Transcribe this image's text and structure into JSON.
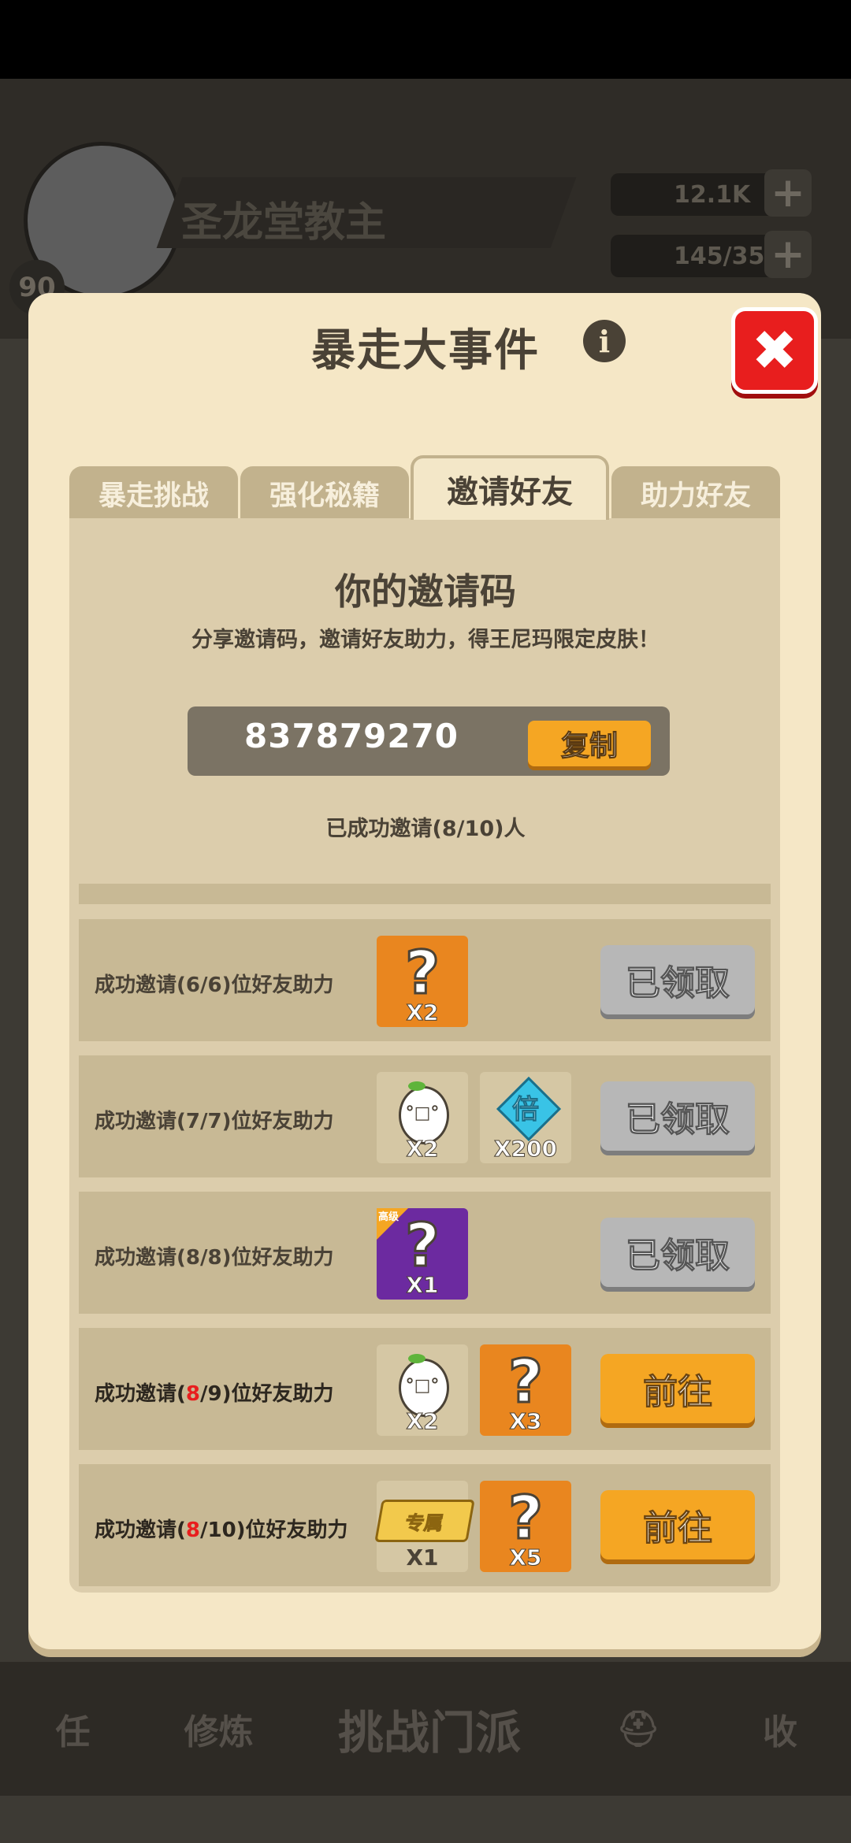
{
  "background": {
    "player_name": "圣龙堂教主",
    "player_level": "90",
    "coins": "12.1K",
    "energy": "145/35",
    "nav": {
      "task": "任",
      "train": "修炼",
      "challenge": "挑战门派",
      "collect": "收"
    }
  },
  "dialog": {
    "title": "暴走大事件",
    "info_glyph": "i",
    "close_glyph": "✖"
  },
  "tabs": [
    {
      "label": "暴走挑战"
    },
    {
      "label": "强化秘籍"
    },
    {
      "label": "邀请好友"
    },
    {
      "label": "助力好友"
    }
  ],
  "invite": {
    "title": "你的邀请码",
    "subtitle": "分享邀请码，邀请好友助力，得王尼玛限定皮肤！",
    "code": "837879270",
    "copy_label": "复制",
    "count_text": "已成功邀请(8/10)人"
  },
  "rewards": [
    {
      "text_pre": "成功邀请(",
      "current": "6",
      "text_post": "/6)位好友助力",
      "items": [
        {
          "icon": "mystery-outfit-icon",
          "qty": "X2"
        }
      ],
      "button": "已领取",
      "status": "claimed"
    },
    {
      "text_pre": "成功邀请(",
      "current": "7",
      "text_post": "/7)位好友助力",
      "items": [
        {
          "icon": "egg-face-icon",
          "qty": "X2"
        },
        {
          "icon": "multiplier-diamond-icon",
          "glyph": "倍",
          "qty": "X200"
        }
      ],
      "button": "已领取",
      "status": "claimed"
    },
    {
      "text_pre": "成功邀请(",
      "current": "8",
      "text_post": "/8)位好友助力",
      "items": [
        {
          "icon": "mystery-purple-icon",
          "corner": "高级",
          "qty": "X1"
        }
      ],
      "button": "已领取",
      "status": "claimed"
    },
    {
      "text_pre": "成功邀请(",
      "current": "8",
      "text_post": "/9)位好友助力",
      "items": [
        {
          "icon": "egg-face-icon",
          "qty": "X2"
        },
        {
          "icon": "mystery-outfit-icon",
          "qty": "X3"
        }
      ],
      "button": "前往",
      "status": "go"
    },
    {
      "text_pre": "成功邀请(",
      "current": "8",
      "text_post": "/10)位好友助力",
      "items": [
        {
          "icon": "exclusive-tag-icon",
          "glyph": "专属",
          "qty": "X1"
        },
        {
          "icon": "mystery-outfit-icon",
          "qty": "X5"
        }
      ],
      "button": "前往",
      "status": "go"
    }
  ],
  "colors": {
    "dialog_bg": "#f5e7c6",
    "panel_bg": "#dccdac",
    "accent_orange": "#f5a623",
    "close_red": "#e81e1e",
    "claimed_gray": "#b7b7b7",
    "text_dark": "#4a4236"
  }
}
